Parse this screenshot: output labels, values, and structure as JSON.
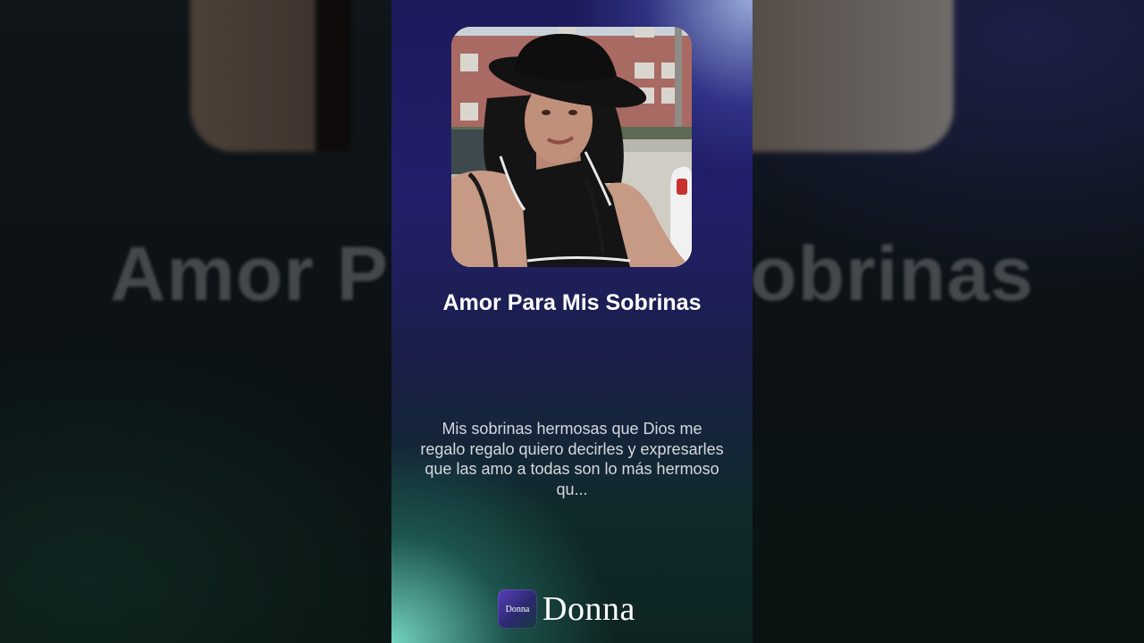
{
  "story": {
    "title": "Amor Para Mis Sobrinas",
    "excerpt": "Mis sobrinas hermosas que Dios me\nregalo regalo quiero decirles y expresarles\nque las amo a todas  son lo más hermoso\nqu...",
    "background_title_left": "Amor P",
    "background_title_right": "obrinas"
  },
  "brand": {
    "icon_text": "Donna",
    "name": "Donna"
  },
  "colors": {
    "card_top": "#1b1a5a",
    "card_bottom": "#0e2422",
    "accent_glow_top": "#aabeeb",
    "accent_glow_bottom": "#78dcc8",
    "title_text": "#ffffff",
    "body_text": "#d6d8dd"
  },
  "icons": {
    "brand_logo": "donna-logo-icon",
    "cover_photo": "woman-in-black-hat-photo"
  }
}
